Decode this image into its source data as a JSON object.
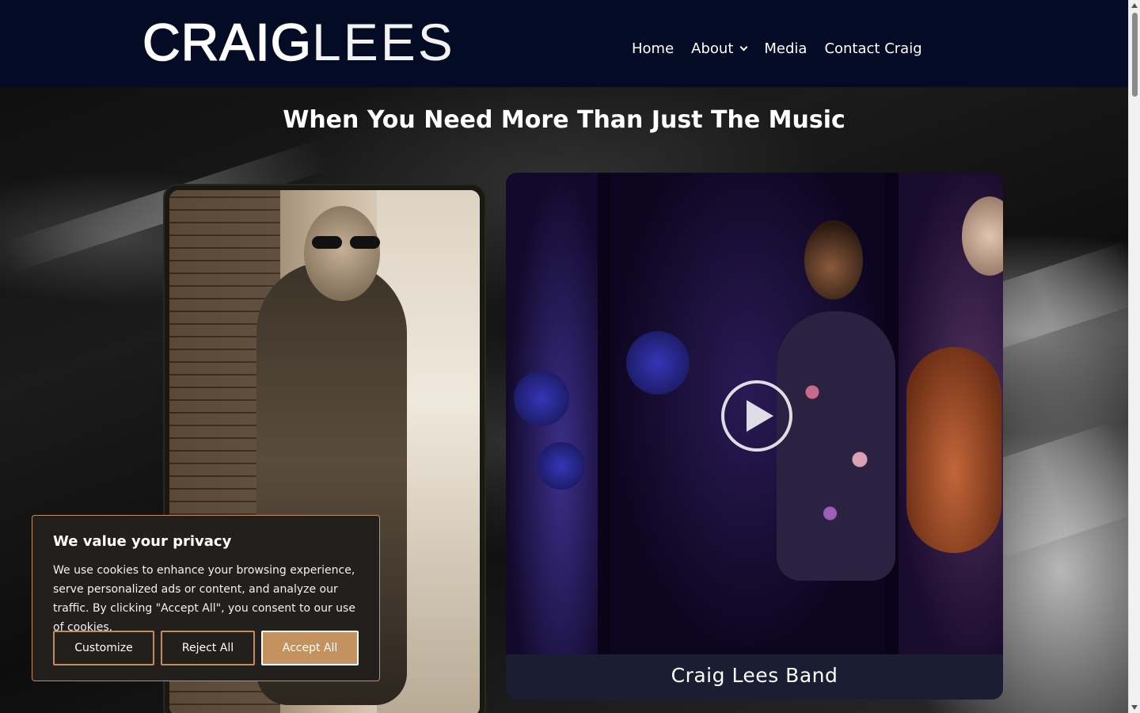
{
  "brand": {
    "logo_bold": "CRAIG",
    "logo_light": "LEES"
  },
  "nav": {
    "items": [
      {
        "label": "Home"
      },
      {
        "label": "About"
      },
      {
        "label": "Media"
      },
      {
        "label": "Contact Craig"
      }
    ]
  },
  "hero": {
    "title": "When You Need More Than Just The Music"
  },
  "video_card": {
    "caption": "Craig Lees Band"
  },
  "cookie_banner": {
    "title": "We value your privacy",
    "body": "We use cookies to enhance your browsing experience, serve personalized ads or content, and analyze our traffic. By clicking \"Accept All\", you consent to our use of cookies.",
    "customize_label": "Customize",
    "reject_label": "Reject All",
    "accept_label": "Accept All"
  },
  "colors": {
    "header_bg": "#040b24",
    "accent": "#c4925f",
    "cookie_bg": "#221f1c"
  }
}
